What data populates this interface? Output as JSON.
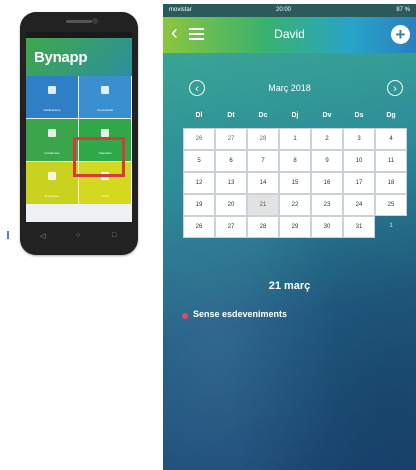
{
  "colors": {
    "highlight": "#d63a3a",
    "event_dot": "#e24b5a",
    "header_gradient": [
      "#8cc63f",
      "#27a3c8",
      "#2b7fc1"
    ]
  },
  "phone_mockup": {
    "logo": "Bynapp",
    "tiles": [
      {
        "label": "Notificacions",
        "color": "#2f7fc6",
        "icon": "bell-icon"
      },
      {
        "label": "Comunicats",
        "color": "#3a8fd0",
        "icon": "message-icon"
      },
      {
        "label": "Incidències",
        "color": "#3aa54a",
        "icon": "document-icon"
      },
      {
        "label": "Calendari",
        "color": "#2fa84a",
        "icon": "calendar-icon"
      },
      {
        "label": "Enquestes",
        "color": "#c8d21f",
        "icon": "list-icon"
      },
      {
        "label": "Perfil",
        "color": "#d4d920",
        "icon": "user-icon"
      }
    ],
    "nav_icons": [
      "back-icon",
      "home-icon",
      "recent-icon"
    ]
  },
  "status_bar": {
    "carrier": "movistar",
    "time": "20:00",
    "battery": "87 %"
  },
  "nav": {
    "title": "David",
    "back_icon": "chevron-left-icon",
    "menu_icon": "hamburger-icon",
    "add_icon": "plus-icon"
  },
  "calendar": {
    "month": "Març 2018",
    "prev_icon": "arrow-left-circle-icon",
    "next_icon": "arrow-right-circle-icon",
    "weekdays": [
      "Dl",
      "Dt",
      "Dc",
      "Dj",
      "Dv",
      "Ds",
      "Dg"
    ],
    "weeks": [
      [
        {
          "d": "26",
          "t": "other"
        },
        {
          "d": "27",
          "t": "other"
        },
        {
          "d": "28",
          "t": "other"
        },
        {
          "d": "1"
        },
        {
          "d": "2"
        },
        {
          "d": "3"
        },
        {
          "d": "4"
        }
      ],
      [
        {
          "d": "5"
        },
        {
          "d": "6"
        },
        {
          "d": "7"
        },
        {
          "d": "8"
        },
        {
          "d": "9"
        },
        {
          "d": "10"
        },
        {
          "d": "11"
        }
      ],
      [
        {
          "d": "12"
        },
        {
          "d": "13"
        },
        {
          "d": "14"
        },
        {
          "d": "15"
        },
        {
          "d": "16"
        },
        {
          "d": "17"
        },
        {
          "d": "18"
        }
      ],
      [
        {
          "d": "19"
        },
        {
          "d": "20"
        },
        {
          "d": "21",
          "t": "selected"
        },
        {
          "d": "22"
        },
        {
          "d": "23"
        },
        {
          "d": "24"
        },
        {
          "d": "25"
        }
      ],
      [
        {
          "d": "26"
        },
        {
          "d": "27"
        },
        {
          "d": "28"
        },
        {
          "d": "29"
        },
        {
          "d": "30"
        },
        {
          "d": "31"
        },
        {
          "d": "1",
          "t": "out"
        }
      ]
    ]
  },
  "selected_date": "21 març",
  "events": {
    "empty_text": "Sense esdeveniments"
  }
}
